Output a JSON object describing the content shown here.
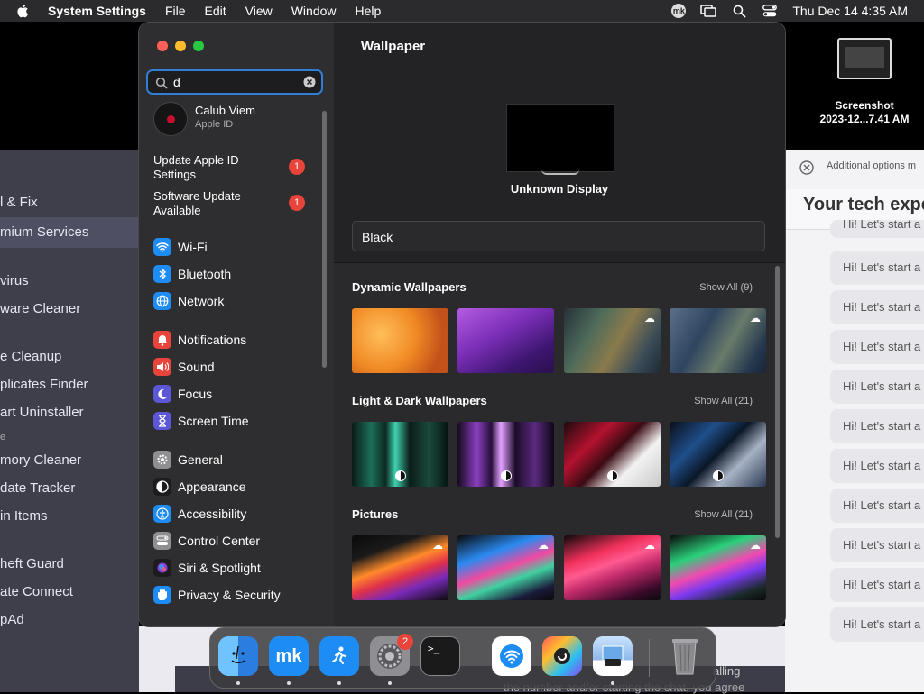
{
  "menubar": {
    "app_name": "System Settings",
    "menus": [
      "File",
      "Edit",
      "View",
      "Window",
      "Help"
    ],
    "clock": "Thu Dec 14  4:35 AM",
    "mk_badge": "mk"
  },
  "desktop": {
    "file_name_line1": "Screenshot",
    "file_name_line2": "2023-12...7.41 AM"
  },
  "background_left": {
    "items": [
      "l & Fix",
      "mium Services",
      "virus",
      "ware Cleaner",
      "e Cleanup",
      "plicates Finder",
      "art Uninstaller",
      "e",
      "mory Cleaner",
      "date Tracker",
      "in Items",
      "heft Guard",
      "ate Connect",
      "pAd"
    ]
  },
  "background_right": {
    "options_text": "Additional options m",
    "heading": "Your tech expe",
    "message": "Hi! Let's start a"
  },
  "background_bottom": {
    "text1": "alling",
    "text2": "the number and/or starting the chat, you agree"
  },
  "settings": {
    "search_value": "d",
    "account_name": "Calub Viem",
    "account_sub": "Apple ID",
    "notices": [
      {
        "label": "Update Apple ID Settings",
        "badge": "1"
      },
      {
        "label": "Software Update Available",
        "badge": "1"
      }
    ],
    "sidebar_items": [
      {
        "label": "Wi-Fi",
        "icon": "wifi-icon",
        "color": "#1e8cf5"
      },
      {
        "label": "Bluetooth",
        "icon": "bluetooth-icon",
        "color": "#1e8cf5"
      },
      {
        "label": "Network",
        "icon": "globe-icon",
        "color": "#1e8cf5"
      },
      {
        "label": "Notifications",
        "icon": "bell-icon",
        "color": "#e9443c"
      },
      {
        "label": "Sound",
        "icon": "speaker-icon",
        "color": "#e9443c"
      },
      {
        "label": "Focus",
        "icon": "moon-icon",
        "color": "#5b57d6"
      },
      {
        "label": "Screen Time",
        "icon": "hourglass-icon",
        "color": "#5b57d6"
      },
      {
        "label": "General",
        "icon": "gear-icon",
        "color": "#8e8e93"
      },
      {
        "label": "Appearance",
        "icon": "appearance-icon",
        "color": "#1c1c1e"
      },
      {
        "label": "Accessibility",
        "icon": "accessibility-icon",
        "color": "#1e8cf5"
      },
      {
        "label": "Control Center",
        "icon": "toggles-icon",
        "color": "#8e8e93"
      },
      {
        "label": "Siri & Spotlight",
        "icon": "siri-icon",
        "color": "#1c1c1e"
      },
      {
        "label": "Privacy & Security",
        "icon": "hand-icon",
        "color": "#1e8cf5"
      }
    ]
  },
  "wallpaper": {
    "title": "Wallpaper",
    "display_label": "Unknown Display",
    "selected": "Black",
    "sections": [
      {
        "title": "Dynamic Wallpapers",
        "show_all": "Show All (9)"
      },
      {
        "title": "Light & Dark Wallpapers",
        "show_all": "Show All (21)"
      },
      {
        "title": "Pictures",
        "show_all": "Show All (21)"
      }
    ]
  },
  "dock": {
    "settings_badge": "2",
    "apps": [
      "finder-icon",
      "mackeeper-icon",
      "fitness-runner-icon",
      "system-settings-icon",
      "terminal-icon",
      "wifi-explorer-icon",
      "system-toolkit-icon",
      "preview-icon",
      "trash-icon"
    ]
  },
  "colors": {
    "accent": "#2f7fd6",
    "badge": "#e8443a",
    "window_bg": "#232325",
    "sidebar_bg": "#2e2e30"
  }
}
